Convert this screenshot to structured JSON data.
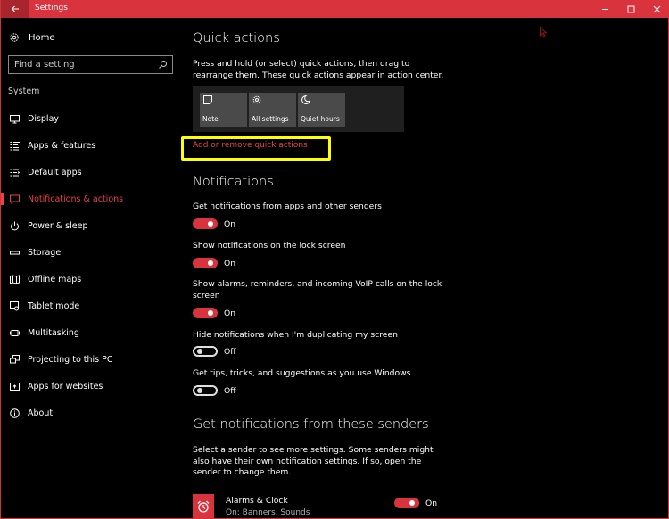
{
  "window": {
    "title": "Settings",
    "accent_color": "#d9333d",
    "back_icon": "arrow-left-icon",
    "controls": [
      "minimize-icon",
      "maximize-icon",
      "close-icon"
    ]
  },
  "sidebar": {
    "home_label": "Home",
    "home_icon": "gear-icon",
    "search_placeholder": "Find a setting",
    "search_icon": "search-icon",
    "section_label": "System",
    "items": [
      {
        "label": "Display",
        "icon": "monitor-icon",
        "active": false
      },
      {
        "label": "Apps & features",
        "icon": "list-icon",
        "active": false
      },
      {
        "label": "Default apps",
        "icon": "default-apps-icon",
        "active": false
      },
      {
        "label": "Notifications & actions",
        "icon": "message-icon",
        "active": true
      },
      {
        "label": "Power & sleep",
        "icon": "power-icon",
        "active": false
      },
      {
        "label": "Storage",
        "icon": "storage-icon",
        "active": false
      },
      {
        "label": "Offline maps",
        "icon": "map-icon",
        "active": false
      },
      {
        "label": "Tablet mode",
        "icon": "tablet-icon",
        "active": false
      },
      {
        "label": "Multitasking",
        "icon": "multitasking-icon",
        "active": false
      },
      {
        "label": "Projecting to this PC",
        "icon": "projecting-icon",
        "active": false
      },
      {
        "label": "Apps for websites",
        "icon": "web-apps-icon",
        "active": false
      },
      {
        "label": "About",
        "icon": "info-icon",
        "active": false
      }
    ]
  },
  "quick_actions": {
    "heading": "Quick actions",
    "description": "Press and hold (or select) quick actions, then drag to rearrange them. These quick actions appear in action center.",
    "tiles": [
      {
        "label": "Note",
        "icon": "note-icon"
      },
      {
        "label": "All settings",
        "icon": "gear-icon"
      },
      {
        "label": "Quiet hours",
        "icon": "moon-icon"
      }
    ],
    "link": "Add or remove quick actions"
  },
  "notifications": {
    "heading": "Notifications",
    "settings": [
      {
        "label": "Get notifications from apps and other senders",
        "state": "On",
        "on": true
      },
      {
        "label": "Show notifications on the lock screen",
        "state": "On",
        "on": true
      },
      {
        "label": "Show alarms, reminders, and incoming VoIP calls on the lock screen",
        "state": "On",
        "on": true
      },
      {
        "label": "Hide notifications when I'm duplicating my screen",
        "state": "Off",
        "on": false
      },
      {
        "label": "Get tips, tricks, and suggestions as you use Windows",
        "state": "Off",
        "on": false
      }
    ]
  },
  "senders": {
    "heading": "Get notifications from these senders",
    "description": "Select a sender to see more settings. Some senders might also have their own notification settings. If so, open the sender to change them.",
    "items": [
      {
        "name": "Alarms & Clock",
        "subtitle": "On: Banners, Sounds",
        "state": "On",
        "on": true,
        "icon": "alarm-clock-icon"
      }
    ]
  }
}
